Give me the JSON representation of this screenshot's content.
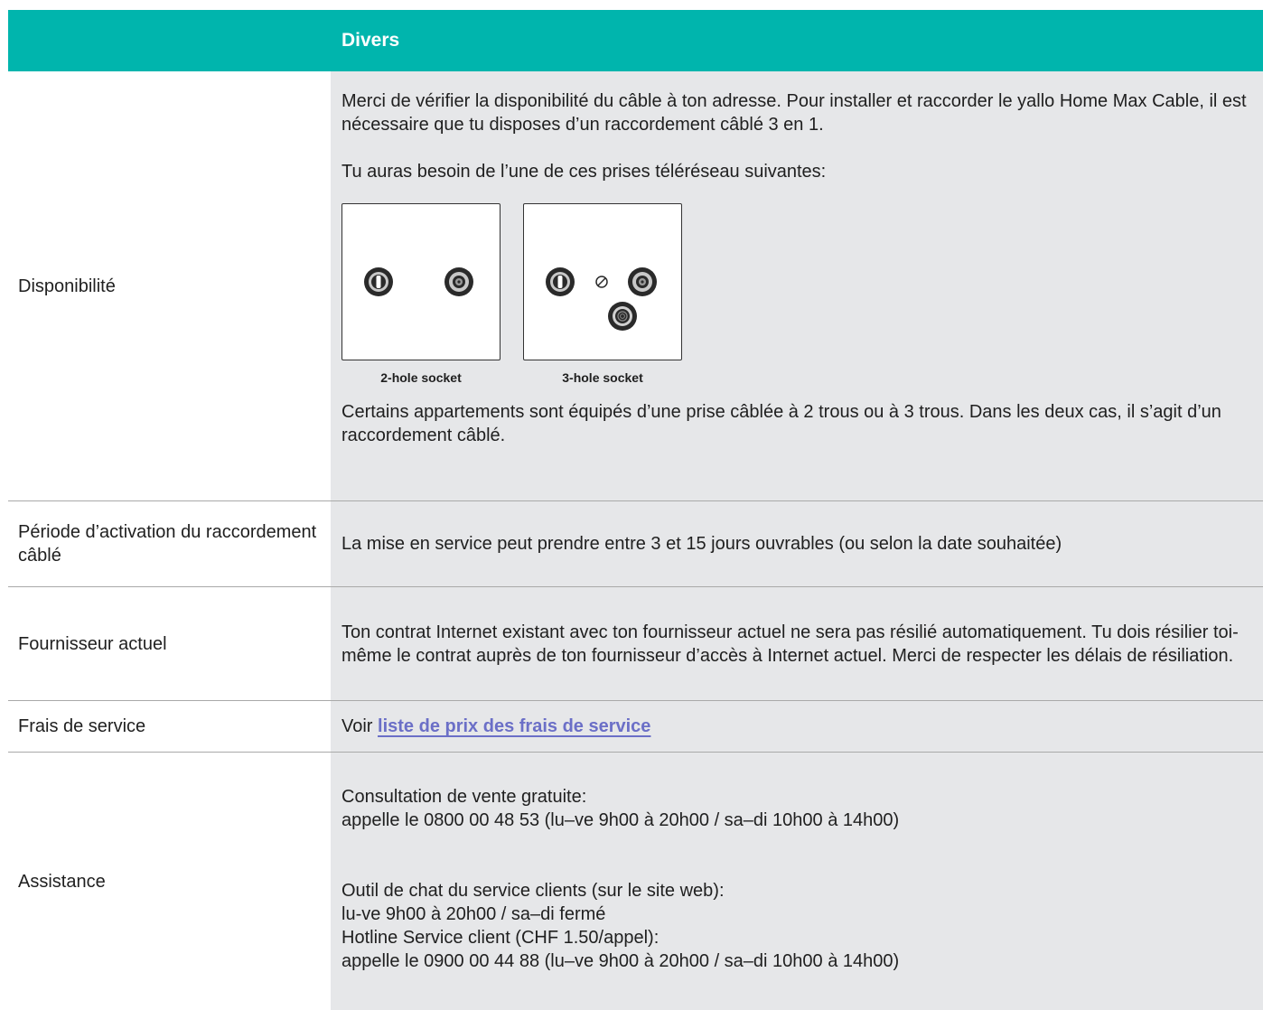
{
  "header": {
    "label": "",
    "title": "Divers"
  },
  "rows": {
    "availability": {
      "label": "Disponibilité",
      "paragraph1": "Merci de vérifier la disponibilité du câble à ton adresse. Pour installer et raccorder le yallo Home Max Cable, il est nécessaire que tu disposes d’un raccordement câblé 3 en 1.",
      "paragraph2": "Tu auras besoin de l’une de ces prises téléréseau suivantes:",
      "sockets": [
        {
          "caption": "2-hole socket",
          "icon": "two-hole-socket-icon"
        },
        {
          "caption": "3-hole socket",
          "icon": "three-hole-socket-icon"
        }
      ],
      "paragraph3": "Certains appartements sont équipés d’une prise câblée à 2 trous ou à 3 trous. Dans les deux cas, il s’agit d’un raccordement câblé."
    },
    "activation_period": {
      "label": "Période d’activation du raccordement câblé",
      "value": "La mise en service peut prendre entre 3 et 15 jours ouvrables (ou selon la date souhaitée)"
    },
    "current_provider": {
      "label": "Fournisseur actuel",
      "value": "Ton contrat Internet existant avec ton fournisseur actuel ne sera pas résilié automatiquement. Tu dois résilier toi-même le contrat auprès de ton fournisseur d’accès à Internet actuel. Merci de respecter les délais de résiliation."
    },
    "service_fees": {
      "label": "Frais de service",
      "prefix": "Voir",
      "link_text": "liste de prix des frais de service"
    },
    "support": {
      "label": "Assistance",
      "sales_title": "Consultation de vente gratuite:",
      "sales_phone": "appelle le 0800 00 48 53 (lu–ve 9h00 à 20h00 / sa–di 10h00 à 14h00)",
      "chat_title": "Outil de chat du service clients (sur le site web):",
      "chat_hours": "lu-ve 9h00 à 20h00 / sa–di fermé",
      "hotline_title": "Hotline Service client (CHF 1.50/appel):",
      "hotline_phone": "appelle le 0900 00 44 88 (lu–ve 9h00 à 20h00 / sa–di 10h00 à 14h00)"
    }
  },
  "colors": {
    "header_bg": "#00b5ad",
    "value_bg": "#e6e7e9",
    "link": "#6b6fc7"
  }
}
